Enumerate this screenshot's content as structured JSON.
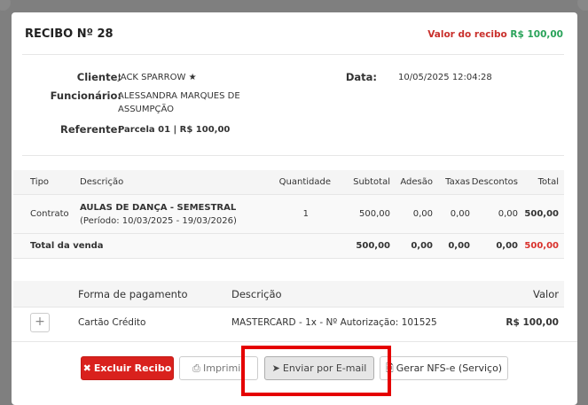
{
  "receipt": {
    "title": "RECIBO Nº 28",
    "valor_label": "Valor do recibo",
    "valor_value": "R$ 100,00"
  },
  "info": {
    "cliente_label": "Cliente:",
    "cliente_value": "JACK SPARROW ★",
    "funcionario_label": "Funcionário:",
    "funcionario_value": "ALESSANDRA MARQUES DE ASSUMPÇÃO",
    "referente_label": "Referente:",
    "referente_value": "Parcela 01 | R$ 100,00",
    "data_label": "Data:",
    "data_value": "10/05/2025 12:04:28"
  },
  "sales": {
    "headers": {
      "tipo": "Tipo",
      "descricao": "Descrição",
      "quantidade": "Quantidade",
      "subtotal": "Subtotal",
      "adesao": "Adesão",
      "taxas": "Taxas",
      "descontos": "Descontos",
      "total": "Total"
    },
    "row": {
      "tipo": "Contrato",
      "descricao_bold": "AULAS DE DANÇA - SEMESTRAL",
      "descricao_rest": " (Período: 10/03/2025 - 19/03/2026)",
      "quantidade": "1",
      "subtotal": "500,00",
      "adesao": "0,00",
      "taxas": "0,00",
      "descontos": "0,00",
      "total": "500,00"
    },
    "totals": {
      "label": "Total da venda",
      "subtotal": "500,00",
      "adesao": "0,00",
      "taxas": "0,00",
      "descontos": "0,00",
      "total": "500,00"
    }
  },
  "payments": {
    "headers": {
      "forma": "Forma de pagamento",
      "descricao": "Descrição",
      "valor": "Valor"
    },
    "row": {
      "forma": "Cartão Crédito",
      "descricao": "MASTERCARD - 1x - Nº Autorização: 101525",
      "valor": "R$ 100,00"
    }
  },
  "buttons": {
    "excluir": "Excluir Recibo",
    "imprimir": "Imprimir",
    "enviar": "Enviar por E-mail",
    "gerar": "Gerar NFS-e (Serviço)"
  },
  "colors": {
    "danger": "#d9211d",
    "success": "#2aa35a",
    "highlight": "#e50000"
  }
}
